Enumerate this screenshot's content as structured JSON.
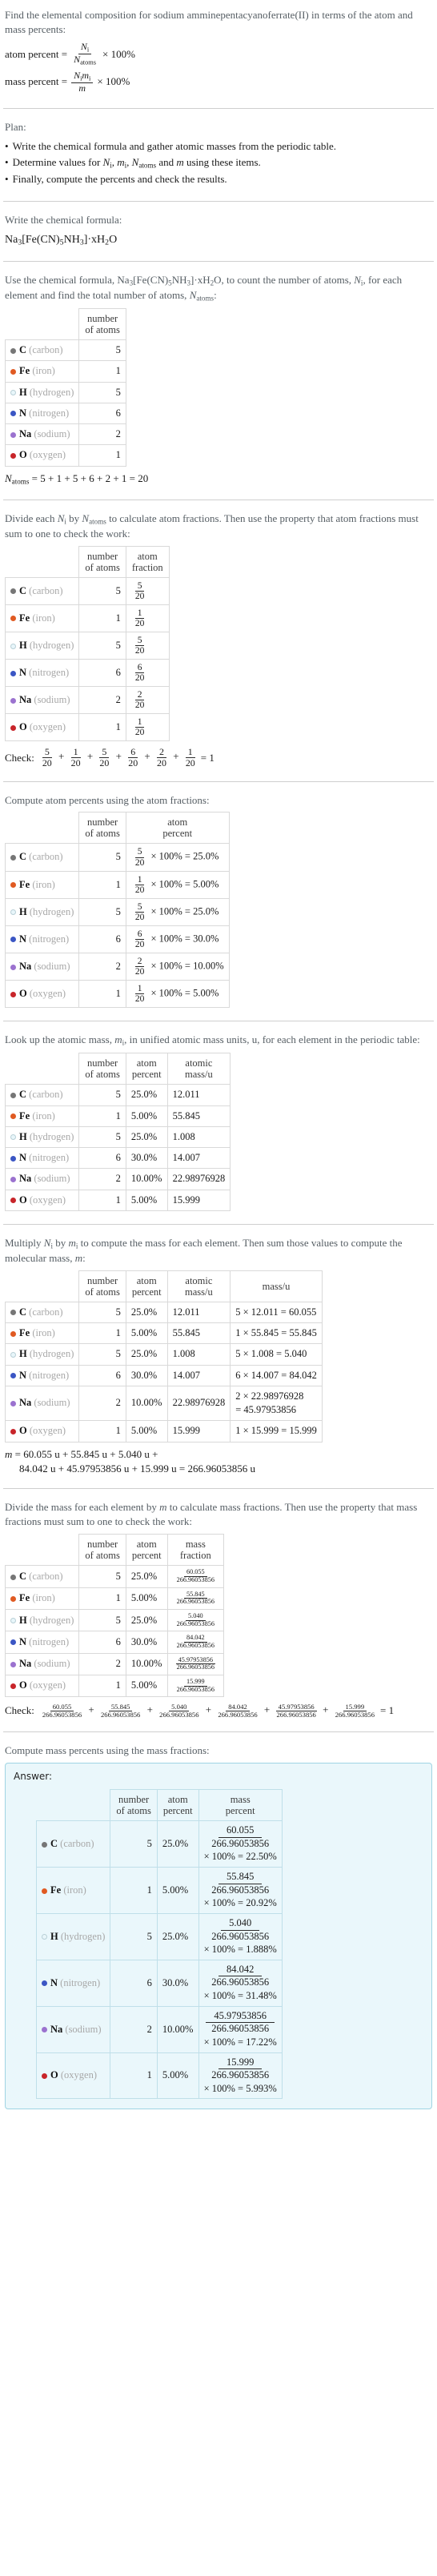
{
  "intro": {
    "question": "Find the elemental composition for sodium amminepentacyanoferrate(II) in terms of the atom and mass percents:",
    "atom_percent_label": "atom percent =",
    "atom_percent_num": "N",
    "atom_percent_num_sub": "i",
    "atom_percent_den": "N",
    "atom_percent_den_sub": "atoms",
    "mass_percent_label": "mass percent =",
    "mass_percent_num": "N",
    "mass_percent_num_sub": "i",
    "mass_percent_num2": "m",
    "mass_percent_num2_sub": "i",
    "mass_percent_den": "m",
    "times100": "× 100%"
  },
  "plan": {
    "title": "Plan:",
    "items": [
      "Write the chemical formula and gather atomic masses from the periodic table.",
      "Determine values for Ni, mi, Natoms and m using these items.",
      "Finally, compute the percents and check the results."
    ]
  },
  "formula_section": {
    "prompt": "Write the chemical formula:",
    "formula_plain": "Na3[Fe(CN)5NH3]·xH2O"
  },
  "atoms_section": {
    "prompt_a": "Use the chemical formula, Na",
    "prompt_b": ", to count the number of atoms, N",
    "prompt_c": ", for each element and find the total number of atoms, N",
    "prompt_d": ":",
    "headers": [
      "",
      "number of atoms"
    ],
    "header_lines": [
      [
        "number",
        "of atoms"
      ]
    ],
    "total_label": "N",
    "total_sub": "atoms",
    "total_expr": "= 5 + 1 + 5 + 6 + 2 + 1 = 20"
  },
  "elements": [
    {
      "symbol": "C",
      "name": "(carbon)",
      "color": "#767676",
      "filled": true,
      "atoms": "5",
      "atom_frac_num": "5",
      "atom_frac_den": "20",
      "atom_percent": "25.0%",
      "atomic_mass": "12.011",
      "mass_expr": "5 × 12.011 = 60.055",
      "mass_expr_line1": "5 × 12.011 = 60.055",
      "mass_expr_line2": "",
      "mass_val": "60.055",
      "mass_percent": "22.50%"
    },
    {
      "symbol": "Fe",
      "name": "(iron)",
      "color": "#e05a22",
      "filled": true,
      "atoms": "1",
      "atom_frac_num": "1",
      "atom_frac_den": "20",
      "atom_percent": "5.00%",
      "atomic_mass": "55.845",
      "mass_expr": "1 × 55.845 = 55.845",
      "mass_expr_line1": "1 × 55.845 = 55.845",
      "mass_expr_line2": "",
      "mass_val": "55.845",
      "mass_percent": "20.92%"
    },
    {
      "symbol": "H",
      "name": "(hydrogen)",
      "color": "#e8f6fa",
      "filled": false,
      "atoms": "5",
      "atom_frac_num": "5",
      "atom_frac_den": "20",
      "atom_percent": "25.0%",
      "atomic_mass": "1.008",
      "mass_expr": "5 × 1.008 = 5.040",
      "mass_expr_line1": "5 × 1.008 = 5.040",
      "mass_expr_line2": "",
      "mass_val": "5.040",
      "mass_percent": "1.888%"
    },
    {
      "symbol": "N",
      "name": "(nitrogen)",
      "color": "#3b56c4",
      "filled": true,
      "atoms": "6",
      "atom_frac_num": "6",
      "atom_frac_den": "20",
      "atom_percent": "30.0%",
      "atomic_mass": "14.007",
      "mass_expr": "6 × 14.007 = 84.042",
      "mass_expr_line1": "6 × 14.007 = 84.042",
      "mass_expr_line2": "",
      "mass_val": "84.042",
      "mass_percent": "31.48%"
    },
    {
      "symbol": "Na",
      "name": "(sodium)",
      "color": "#9b72cf",
      "filled": true,
      "atoms": "2",
      "atom_frac_num": "2",
      "atom_frac_den": "20",
      "atom_percent": "10.00%",
      "atomic_mass": "22.98976928",
      "mass_expr": "2 × 22.98976928 = 45.97953856",
      "mass_expr_line1": "2 × 22.98976928",
      "mass_expr_line2": "= 45.97953856",
      "mass_val": "45.97953856",
      "mass_percent": "17.22%"
    },
    {
      "symbol": "O",
      "name": "(oxygen)",
      "color": "#c8252a",
      "filled": true,
      "atoms": "1",
      "atom_frac_num": "1",
      "atom_frac_den": "20",
      "atom_percent": "5.00%",
      "atomic_mass": "15.999",
      "mass_expr": "1 × 15.999 = 15.999",
      "mass_expr_line1": "1 × 15.999 = 15.999",
      "mass_expr_line2": "",
      "mass_val": "15.999",
      "mass_percent": "5.993%"
    }
  ],
  "atom_fraction_section": {
    "prompt": "Divide each Ni by Natoms to calculate atom fractions. Then use the property that atom fractions must sum to one to check the work:",
    "col_headers": [
      [
        "number",
        "of atoms"
      ],
      [
        "atom",
        "fraction"
      ]
    ],
    "check_label": "Check:",
    "check_result": "= 1"
  },
  "atom_percent_section": {
    "prompt": "Compute atom percents using the atom fractions:",
    "col_headers": [
      [
        "number",
        "of atoms"
      ],
      [
        "atom",
        "percent"
      ]
    ],
    "times100": "× 100% ="
  },
  "atomic_mass_section": {
    "prompt": "Look up the atomic mass, mi, in unified atomic mass units, u, for each element in the periodic table:",
    "col_headers": [
      [
        "number",
        "of atoms"
      ],
      [
        "atom",
        "percent"
      ],
      [
        "atomic",
        "mass/u"
      ]
    ]
  },
  "mass_section": {
    "prompt": "Multiply Ni by mi to compute the mass for each element. Then sum those values to compute the molecular mass, m:",
    "col_headers": [
      [
        "number",
        "of atoms"
      ],
      [
        "atom",
        "percent"
      ],
      [
        "atomic",
        "mass/u"
      ],
      [
        "mass/u",
        ""
      ]
    ],
    "sum_line1": "m = 60.055 u + 55.845 u + 5.040 u +",
    "sum_line2": "84.042 u + 45.97953856 u + 15.999 u = 266.96053856 u"
  },
  "mass_fraction_section": {
    "prompt": "Divide the mass for each element by m to calculate mass fractions. Then use the property that mass fractions must sum to one to check the work:",
    "col_headers": [
      [
        "number",
        "of atoms"
      ],
      [
        "atom",
        "percent"
      ],
      [
        "mass",
        "fraction"
      ]
    ],
    "molecular_mass": "266.96053856",
    "check_label": "Check:",
    "check_result": "= 1"
  },
  "mass_percent_section": {
    "prompt": "Compute mass percents using the mass fractions:",
    "answer_label": "Answer:",
    "col_headers": [
      [
        "number",
        "of atoms"
      ],
      [
        "atom",
        "percent"
      ],
      [
        "mass",
        "percent"
      ]
    ],
    "molecular_mass": "266.96053856",
    "times100": "× 100% ="
  }
}
